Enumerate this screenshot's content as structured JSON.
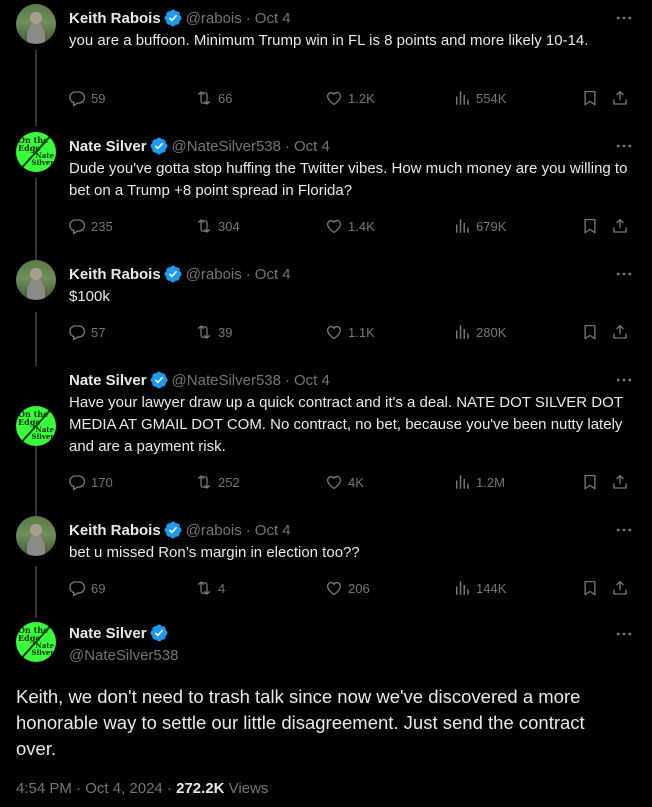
{
  "colors": {
    "background": "#000000",
    "text": "#e7e9ea",
    "muted": "#71767b",
    "verified": "#1d9bf0",
    "nate_avatar": "#39ff3a"
  },
  "avatars": {
    "nate": {
      "line1": "On the Edge",
      "line2": "Nate Silver"
    }
  },
  "replies": [
    {
      "name": "Keith Rabois",
      "handle": "@rabois",
      "sep": "·",
      "date": "Oct 4",
      "text": "you are a buffoon.  Minimum Trump win in FL is 8 points and more likely 10-14.",
      "stats": {
        "replies": "59",
        "reposts": "66",
        "likes": "1.2K",
        "views": "554K"
      }
    },
    {
      "name": "Nate Silver",
      "handle": "@NateSilver538",
      "sep": "·",
      "date": "Oct 4",
      "text": "Dude you've gotta stop huffing the Twitter vibes. How much money are you willing to bet on a Trump +8 point spread in Florida?",
      "stats": {
        "replies": "235",
        "reposts": "304",
        "likes": "1.4K",
        "views": "679K"
      }
    },
    {
      "name": "Keith Rabois",
      "handle": "@rabois",
      "sep": "·",
      "date": "Oct 4",
      "text": "$100k",
      "stats": {
        "replies": "57",
        "reposts": "39",
        "likes": "1.1K",
        "views": "280K"
      }
    },
    {
      "name": "Nate Silver",
      "handle": "@NateSilver538",
      "sep": "·",
      "date": "Oct 4",
      "text": "Have your lawyer draw up a quick contract and it's a deal. NATE DOT SILVER DOT MEDIA AT GMAIL DOT COM. No contract, no bet, because you've been nutty lately and are a payment risk.",
      "stats": {
        "replies": "170",
        "reposts": "252",
        "likes": "4K",
        "views": "1.2M"
      }
    },
    {
      "name": "Keith Rabois",
      "handle": "@rabois",
      "sep": "·",
      "date": "Oct 4",
      "text": "bet u missed Ron’s margin in election too??",
      "stats": {
        "replies": "69",
        "reposts": "4",
        "likes": "206",
        "views": "144K"
      }
    }
  ],
  "main": {
    "name": "Nate Silver",
    "handle": "@NateSilver538",
    "text": "Keith, we don't need to trash talk since now we've discovered a more honorable way to settle our little disagreement. Just send the contract over.",
    "time": "4:54 PM",
    "sep": "·",
    "date": "Oct 4, 2024",
    "sep2": "·",
    "views_count": "272.2K",
    "views_label": "Views"
  }
}
